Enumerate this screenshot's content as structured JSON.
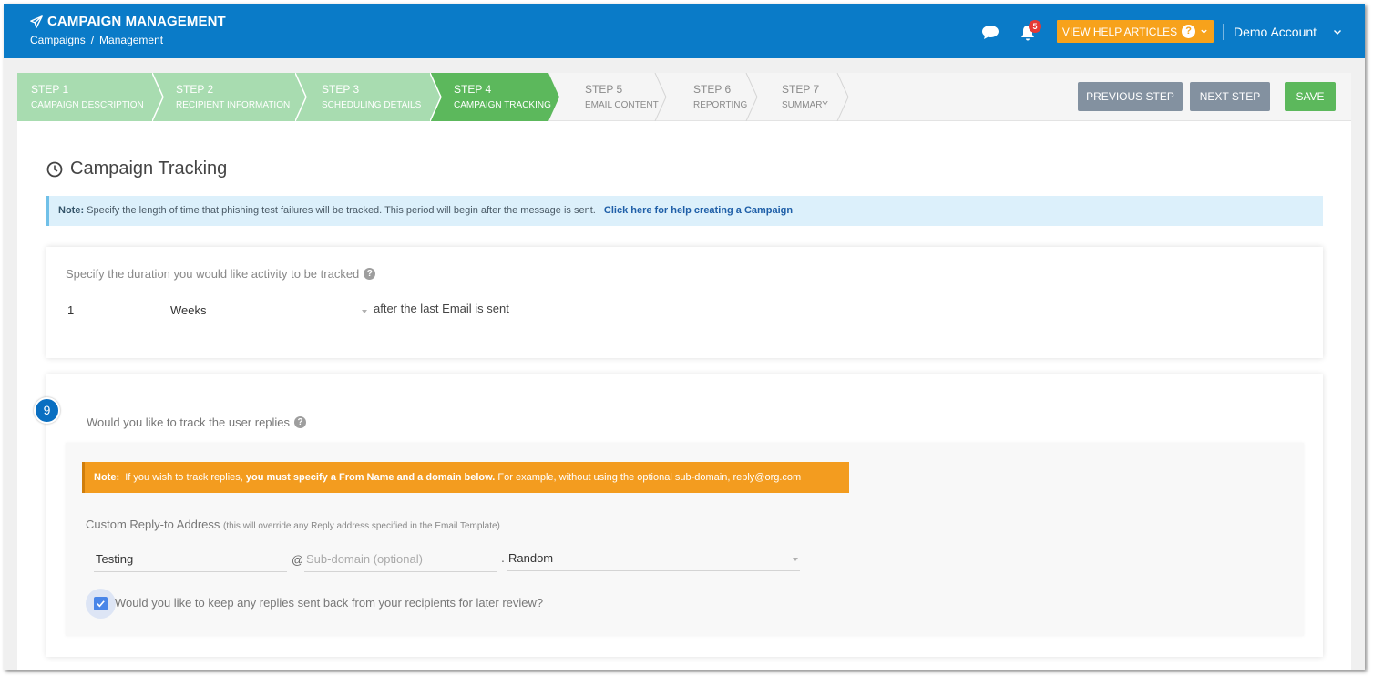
{
  "header": {
    "title": "CAMPAIGN MANAGEMENT",
    "title_icon": "paper-plane-icon",
    "breadcrumb": [
      "Campaigns",
      "/",
      "Management"
    ],
    "notification_count": "5",
    "help_button": "VIEW HELP ARTICLES",
    "account": "Demo Account",
    "colors": {
      "bar": "#0a7bc8",
      "help": "#f7a21b"
    }
  },
  "stepper": {
    "steps": [
      {
        "label": "STEP 1",
        "sub": "CAMPAIGN DESCRIPTION",
        "state": "done"
      },
      {
        "label": "STEP 2",
        "sub": "RECIPIENT INFORMATION",
        "state": "done"
      },
      {
        "label": "STEP 3",
        "sub": "SCHEDULING DETAILS",
        "state": "done"
      },
      {
        "label": "STEP 4",
        "sub": "CAMPAIGN TRACKING",
        "state": "active"
      },
      {
        "label": "STEP 5",
        "sub": "EMAIL CONTENT",
        "state": "todo"
      },
      {
        "label": "STEP 6",
        "sub": "REPORTING",
        "state": "todo"
      },
      {
        "label": "STEP 7",
        "sub": "SUMMARY",
        "state": "todo"
      }
    ],
    "colors": {
      "done": "#a8dcb0",
      "active": "#5cb85c",
      "todo": "#f5f5f5"
    },
    "buttons": {
      "previous": "PREVIOUS STEP",
      "next": "NEXT STEP",
      "save": "SAVE"
    }
  },
  "section": {
    "title": "Campaign Tracking",
    "icon": "clock-icon"
  },
  "note": {
    "prefix": "Note:",
    "text": "Specify the length of time that phishing test failures will be tracked. This period will begin after the message is sent.",
    "link": "Click here for help creating a Campaign"
  },
  "duration": {
    "label": "Specify the duration you would like activity to be tracked",
    "value": "1",
    "unit": "Weeks",
    "suffix": "after the last Email is sent"
  },
  "replies": {
    "annotation": "9",
    "track_label": "Would you like to track the user replies",
    "track_checked": true,
    "warning_prefix": "Note:",
    "warning_text_1": "If you wish to track replies,",
    "warning_bold": "you must specify a From Name and a domain below.",
    "warning_text_2": "For example, without using the optional sub-domain, reply@org.com",
    "reply_label": "Custom Reply-to Address",
    "reply_hint": "(this will override any Reply address specified in the Email Template)",
    "name_value": "Testing",
    "at": "@",
    "subdomain_placeholder": "Sub-domain (optional)",
    "dot": ".",
    "domain_value": "Random",
    "keep_label": "Would you like to keep any replies sent back from your recipients for later review?",
    "keep_checked": true
  }
}
